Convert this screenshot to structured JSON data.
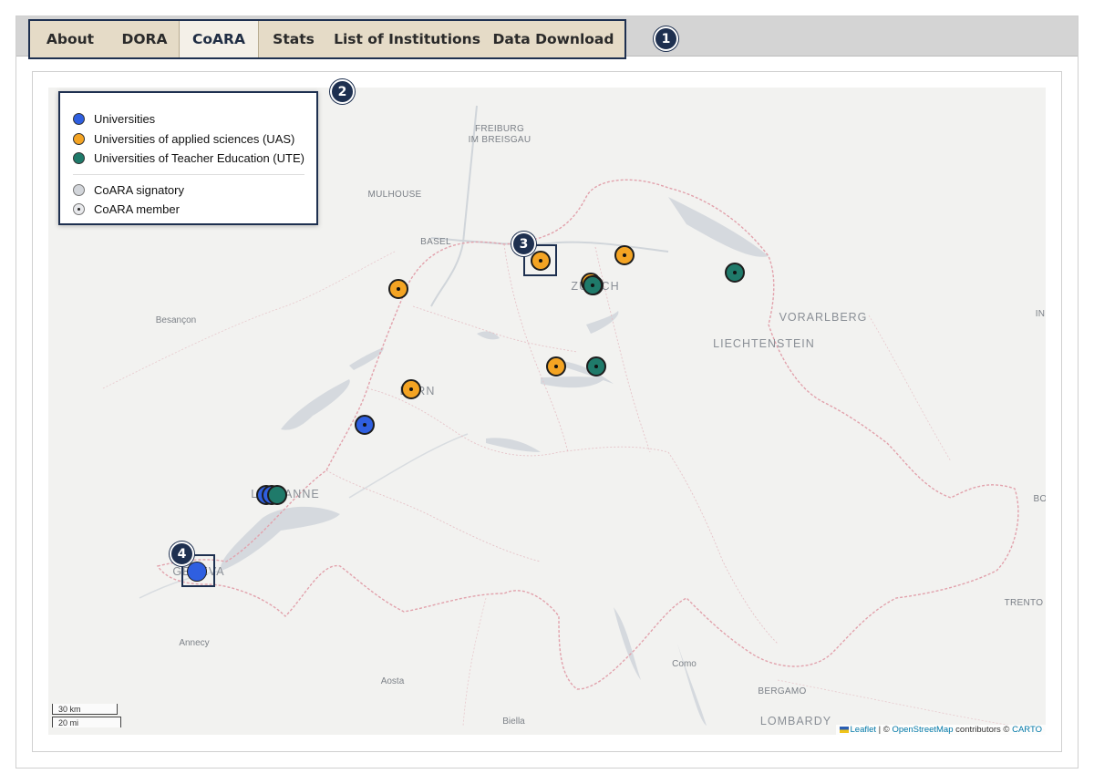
{
  "tabs": [
    {
      "label": "About"
    },
    {
      "label": "DORA"
    },
    {
      "label": "CoARA",
      "active": true
    },
    {
      "label": "Stats"
    },
    {
      "label": "List of Institutions"
    },
    {
      "label": "Data Download"
    }
  ],
  "badges": [
    "1",
    "2",
    "3",
    "4"
  ],
  "legend": {
    "items": [
      {
        "label": "Universities",
        "color": "#2f5fe0"
      },
      {
        "label": "Universities of applied sciences (UAS)",
        "color": "#f4a423"
      },
      {
        "label": "Universities of Teacher Education (UTE)",
        "color": "#1f7a6a"
      }
    ],
    "status": [
      {
        "label": "CoARA signatory",
        "color": "#d2d5da"
      },
      {
        "label": "CoARA member",
        "color": "#e8e9ec"
      }
    ]
  },
  "map_labels": {
    "freiburg": "FREIBURG\nIM BREISGAU",
    "mulhouse": "MULHOUSE",
    "basel": "BASEL",
    "zurich": "ZÜRICH",
    "besancon": "Besançon",
    "vorarlberg": "VORARLBERG",
    "liechtenstein": "LIECHTENSTEIN",
    "bern": "BERN",
    "lausanne": "LAUSANNE",
    "geneva": "GENEVA",
    "annecy": "Annecy",
    "aosta": "Aosta",
    "biella": "Biella",
    "como": "Como",
    "bergamo": "BERGAMO",
    "lombardy": "LOMBARDY",
    "trento": "TRENTO",
    "edge_in": "IN",
    "edge_bo": "BO"
  },
  "scale": {
    "km": "30 km",
    "mi": "20 mi"
  },
  "attribution": {
    "leaflet": "Leaflet",
    "sep1": " | © ",
    "osm": "OpenStreetMap",
    "mid": " contributors © ",
    "carto": "CARTO"
  },
  "colors": {
    "university": "#2f5fe0",
    "uas": "#f4a423",
    "ute": "#1f7a6a",
    "accent": "#1e3050"
  }
}
